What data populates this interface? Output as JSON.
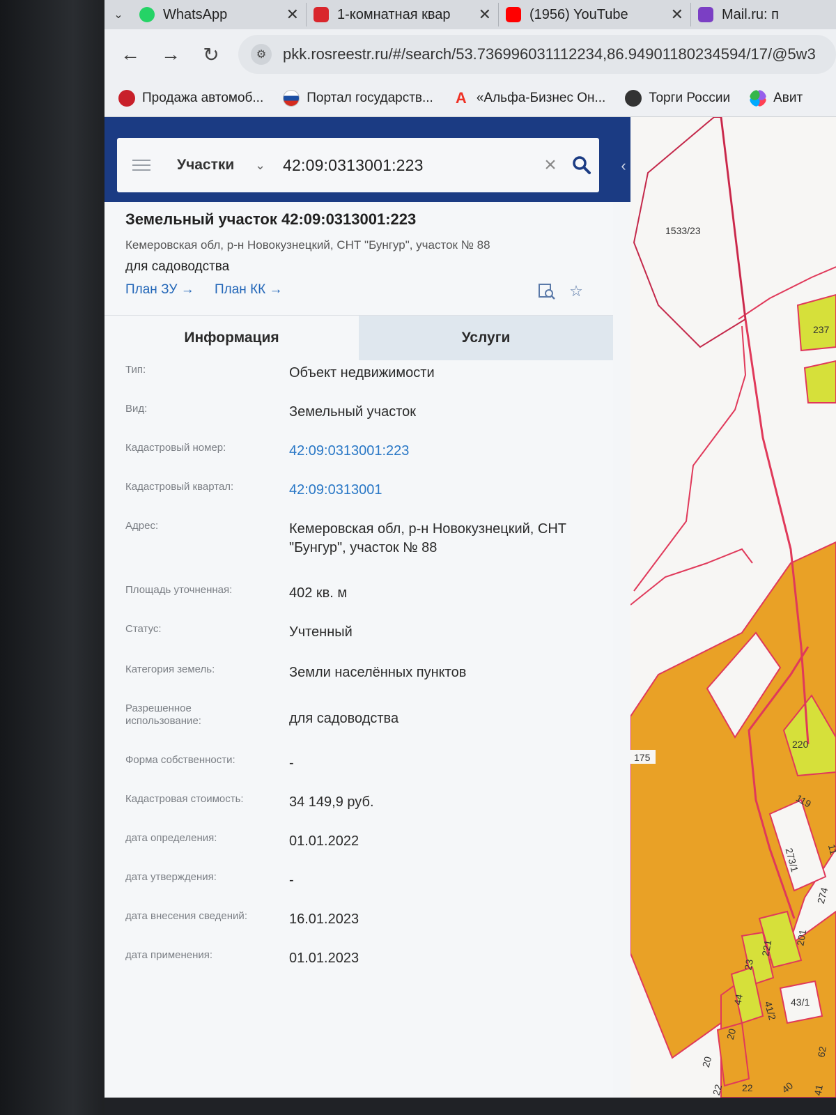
{
  "browser": {
    "tabs": [
      {
        "label": "WhatsApp",
        "icon": "whatsapp-icon",
        "color": "#25d366"
      },
      {
        "label": "1-комнатная квар",
        "icon": "listing-icon",
        "color": "#d9262c"
      },
      {
        "label": "(1956) YouTube",
        "icon": "youtube-icon",
        "color": "#ff0000"
      },
      {
        "label": "Mail.ru: п",
        "icon": "mailru-icon",
        "color": "#7b3fc4"
      }
    ],
    "url": "pkk.rosreestr.ru/#/search/53.736996031112234,86.94901180234594/17/@5w3",
    "bookmarks": [
      {
        "label": "Продажа автомоб...",
        "icon": "drom-icon",
        "color": "#c8202a"
      },
      {
        "label": "Портал государств...",
        "icon": "gosuslugi-icon",
        "color": "#1d4fa3"
      },
      {
        "label": "«Альфа-Бизнес Он...",
        "icon": "alfa-icon",
        "color": "#ef3124"
      },
      {
        "label": "Торги России",
        "icon": "torgi-icon",
        "color": "#333333"
      },
      {
        "label": "Авит",
        "icon": "avito-icon",
        "color": "#35b64a"
      }
    ]
  },
  "search": {
    "category": "Участки",
    "query": "42:09:0313001:223"
  },
  "object": {
    "title": "Земельный участок 42:09:0313001:223",
    "address": "Кемеровская обл, р-н Новокузнецкий, СНТ \"Бунгур\", участок № 88",
    "purpose": "для садоводства",
    "plan_zu": "План ЗУ →",
    "plan_kk": "План КК →"
  },
  "panel_tabs": {
    "info": "Информация",
    "services": "Услуги"
  },
  "info_rows": [
    {
      "label": "Тип:",
      "value": "Объект недвижимости"
    },
    {
      "label": "Вид:",
      "value": "Земельный участок"
    },
    {
      "label": "Кадастровый номер:",
      "value": "42:09:0313001:223"
    },
    {
      "label": "Кадастровый квартал:",
      "value": "42:09:0313001"
    },
    {
      "label": "Адрес:",
      "value": "Кемеровская обл, р-н Новокузнецкий, СНТ \"Бунгур\", участок № 88"
    },
    {
      "label": "Площадь уточненная:",
      "value": "402 кв. м"
    },
    {
      "label": "Статус:",
      "value": "Учтенный"
    },
    {
      "label": "Категория земель:",
      "value": "Земли населённых пунктов"
    },
    {
      "label": "Разрешенное использование:",
      "value": "для садоводства"
    },
    {
      "label": "Форма собственности:",
      "value": "-"
    },
    {
      "label": "Кадастровая стоимость:",
      "value": "34 149,9 руб."
    },
    {
      "label": "дата определения:",
      "value": "01.01.2022"
    },
    {
      "label": "дата утверждения:",
      "value": "-"
    },
    {
      "label": "дата внесения сведений:",
      "value": "16.01.2023"
    },
    {
      "label": "дата применения:",
      "value": "01.01.2023"
    }
  ],
  "map": {
    "labels": [
      "1533/23",
      "237",
      "220",
      "175",
      "119",
      "273/1",
      "274",
      "201",
      "221",
      "23",
      "44",
      "41/2",
      "43/1",
      "20",
      "20",
      "22",
      "22",
      "40",
      "62",
      "41",
      "11"
    ],
    "colors": {
      "parcel_orange": "#e9a126",
      "parcel_yellow": "#d6e03a",
      "boundary": "#e0395a"
    }
  }
}
